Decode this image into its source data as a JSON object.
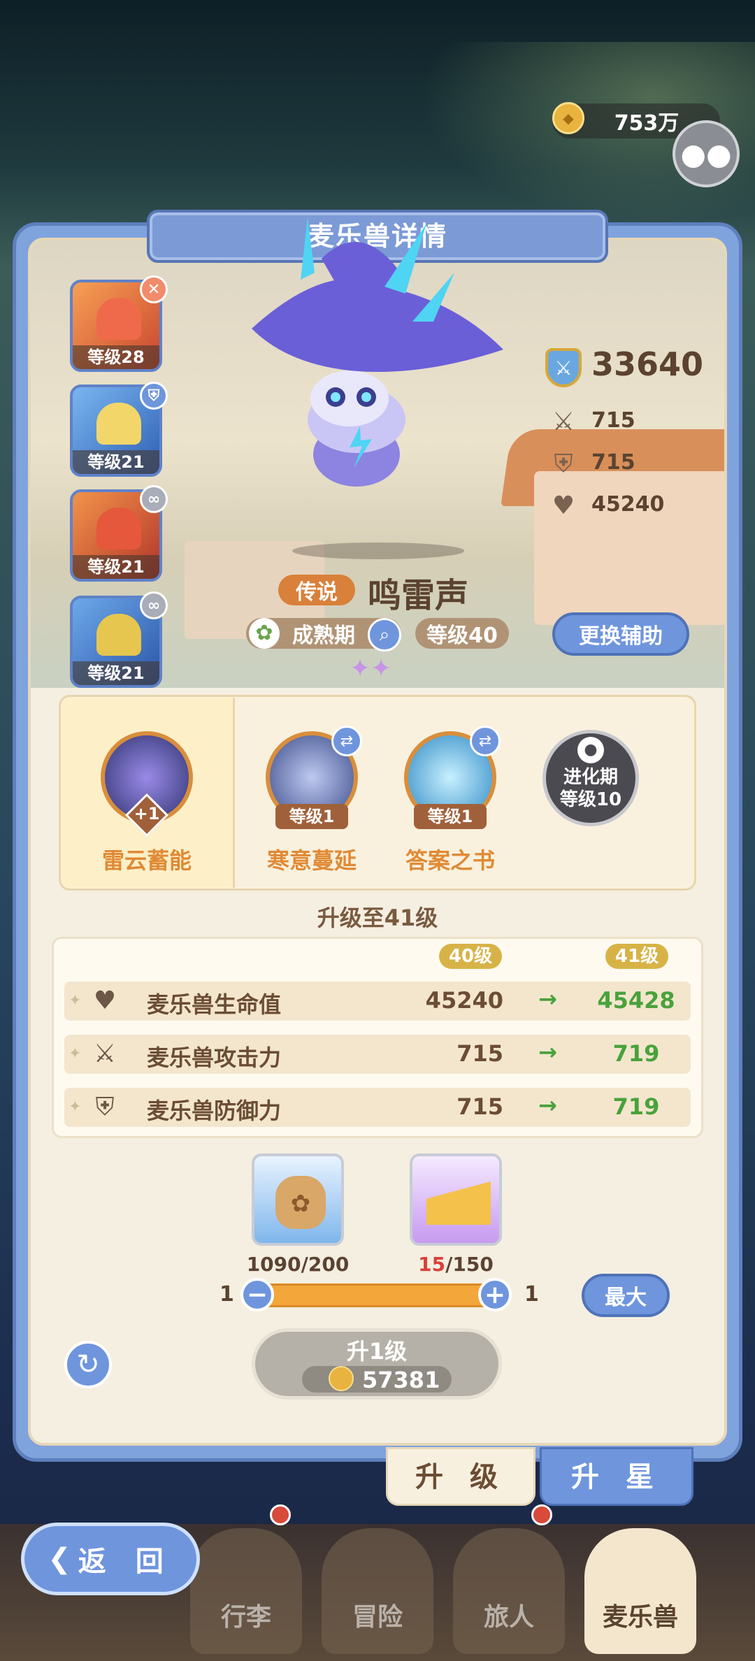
{
  "currency": {
    "amount": "753万",
    "icon": "coin-icon"
  },
  "chat": {
    "icon": "chat-bubble-icon"
  },
  "panel": {
    "title": "麦乐兽详情"
  },
  "side_pets": [
    {
      "level": "等级28",
      "badge_icon": "remove-icon"
    },
    {
      "level": "等级21",
      "badge_icon": "shield-icon"
    },
    {
      "level": "等级21",
      "badge_icon": "link-icon"
    },
    {
      "level": "等级21",
      "badge_icon": "link-icon"
    }
  ],
  "pet": {
    "rarity": "传说",
    "name": "鸣雷声",
    "stage": "成熟期",
    "level": "等级40",
    "change_assist": "更换辅助"
  },
  "stats": {
    "power": "33640",
    "attack": "715",
    "defense": "715",
    "hp": "45240"
  },
  "skills": [
    {
      "name": "雷云蓄能",
      "badge": "+1",
      "selected": true
    },
    {
      "name": "寒意蔓延",
      "level": "等级1"
    },
    {
      "name": "答案之书",
      "level": "等级1"
    },
    {
      "locked_line1": "进化期",
      "locked_line2": "等级10"
    }
  ],
  "upgrade": {
    "title": "升级至41级",
    "from_level": "40级",
    "to_level": "41级",
    "rows": [
      {
        "name": "麦乐兽生命值",
        "old": "45240",
        "new": "45428",
        "icon": "heart-icon"
      },
      {
        "name": "麦乐兽攻击力",
        "old": "715",
        "new": "719",
        "icon": "swords-icon"
      },
      {
        "name": "麦乐兽防御力",
        "old": "715",
        "new": "719",
        "icon": "shield-icon"
      }
    ],
    "items": [
      {
        "have": "1090",
        "need": "/200",
        "icon": "food-bag-icon"
      },
      {
        "have": "15",
        "need": "/150",
        "icon": "cheese-icon"
      }
    ],
    "slider_min": "1",
    "slider_max": "1",
    "max_label": "最大",
    "button_label": "升1级",
    "cost": "57381"
  },
  "tabs": {
    "upgrade": "升 级",
    "star": "升 星"
  },
  "nav": {
    "back": "返 回",
    "items": [
      "行李",
      "冒险",
      "旅人",
      "麦乐兽"
    ]
  },
  "colors": {
    "panel_blue": "#7fa3dd",
    "accent_orange": "#e08a36",
    "green": "#49a23c",
    "gold": "#d7b347"
  }
}
